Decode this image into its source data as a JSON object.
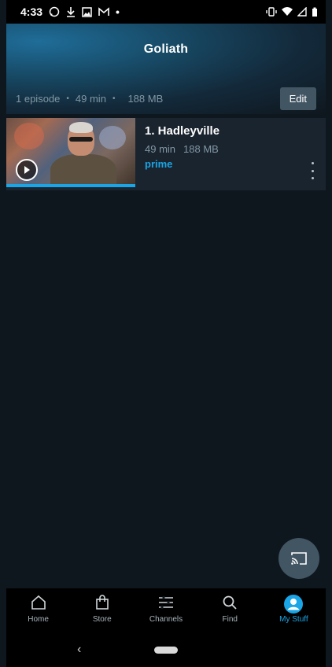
{
  "status_bar": {
    "time": "4:33"
  },
  "header": {
    "title": "Goliath"
  },
  "summary": {
    "episodes": "1 episode",
    "duration": "49 min",
    "size": "188 MB",
    "edit_label": "Edit"
  },
  "episode": {
    "title": "1. Hadleyville",
    "duration": "49 min",
    "size": "188 MB",
    "badge": "prime",
    "watch_progress_percent": 100
  },
  "nav": [
    {
      "label": "Home",
      "icon": "home-icon"
    },
    {
      "label": "Store",
      "icon": "bag-icon"
    },
    {
      "label": "Channels",
      "icon": "channels-icon"
    },
    {
      "label": "Find",
      "icon": "search-icon"
    },
    {
      "label": "My Stuff",
      "icon": "profile-icon",
      "active": true
    }
  ],
  "colors": {
    "accent": "#1aa5e6",
    "background": "#0f171e",
    "card": "#1a242f",
    "button": "#425563"
  }
}
